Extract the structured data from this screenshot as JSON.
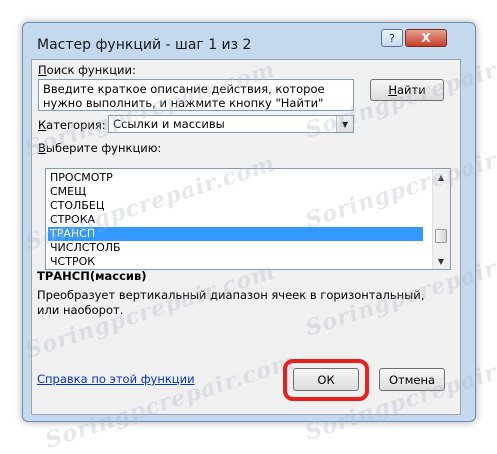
{
  "window": {
    "title": "Мастер функций - шаг 1 из 2",
    "help_glyph": "?",
    "close_glyph": "X"
  },
  "search": {
    "label_underlined": "П",
    "label_rest": "оиск функции:",
    "text": "Введите краткое описание действия, которое нужно выполнить, и нажмите кнопку \"Найти\"",
    "button_underlined": "Н",
    "button_rest": "айти"
  },
  "category": {
    "label_underlined": "К",
    "label_rest": "атегория:",
    "value": "Ссылки и массивы"
  },
  "functions": {
    "label_underlined": "В",
    "label_rest": "ыберите функцию:",
    "items": [
      "ПРОСМОТР",
      "СМЕЩ",
      "СТОЛБЕЦ",
      "СТРОКА",
      "ТРАНСП",
      "ЧИСЛСТОЛБ",
      "ЧСТРОК"
    ],
    "selected_index": 4
  },
  "details": {
    "signature": "ТРАНСП(массив)",
    "description": "Преобразует вертикальный диапазон ячеек в горизонтальный, или наоборот."
  },
  "footer": {
    "help_link": "Справка по этой функции",
    "ok": "ОК",
    "cancel": "Отмена"
  },
  "highlight_color": "#e8201e",
  "watermark": "Soringpcrepair.com"
}
